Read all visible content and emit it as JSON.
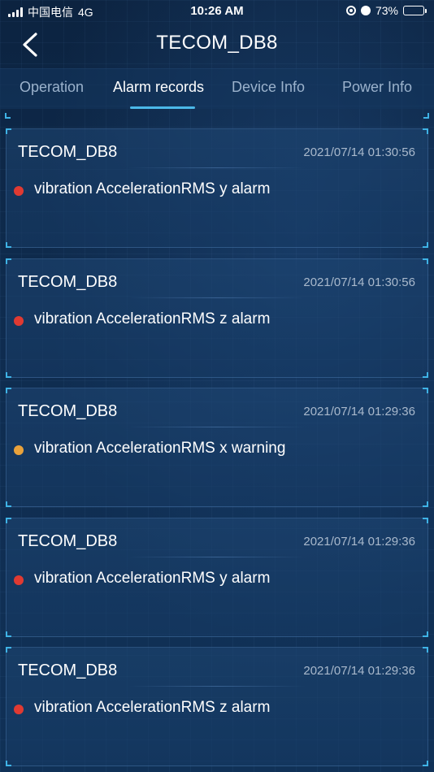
{
  "status_bar": {
    "carrier": "中国电信",
    "network": "4G",
    "time": "10:26 AM",
    "battery": "73%",
    "battery_level": 0.73
  },
  "nav": {
    "title": "TECOM_DB8",
    "back_icon": "chevron-left-icon"
  },
  "tabs": [
    {
      "label": "Operation",
      "active": false
    },
    {
      "label": "Alarm records",
      "active": true
    },
    {
      "label": "Device Info",
      "active": false
    },
    {
      "label": "Power Info",
      "active": false
    }
  ],
  "colors": {
    "accent": "#4bb8e8",
    "alarm": "#e03a32",
    "warning": "#e9a23b"
  },
  "records": [
    {
      "device": "TECOM_DB8",
      "time": "2021/07/14 01:30:56",
      "message": "vibration AccelerationRMS y alarm",
      "level": "alarm"
    },
    {
      "device": "TECOM_DB8",
      "time": "2021/07/14 01:30:56",
      "message": "vibration AccelerationRMS z alarm",
      "level": "alarm"
    },
    {
      "device": "TECOM_DB8",
      "time": "2021/07/14 01:29:36",
      "message": "vibration AccelerationRMS x warning",
      "level": "warning"
    },
    {
      "device": "TECOM_DB8",
      "time": "2021/07/14 01:29:36",
      "message": "vibration AccelerationRMS y alarm",
      "level": "alarm"
    },
    {
      "device": "TECOM_DB8",
      "time": "2021/07/14 01:29:36",
      "message": "vibration AccelerationRMS z alarm",
      "level": "alarm"
    }
  ]
}
